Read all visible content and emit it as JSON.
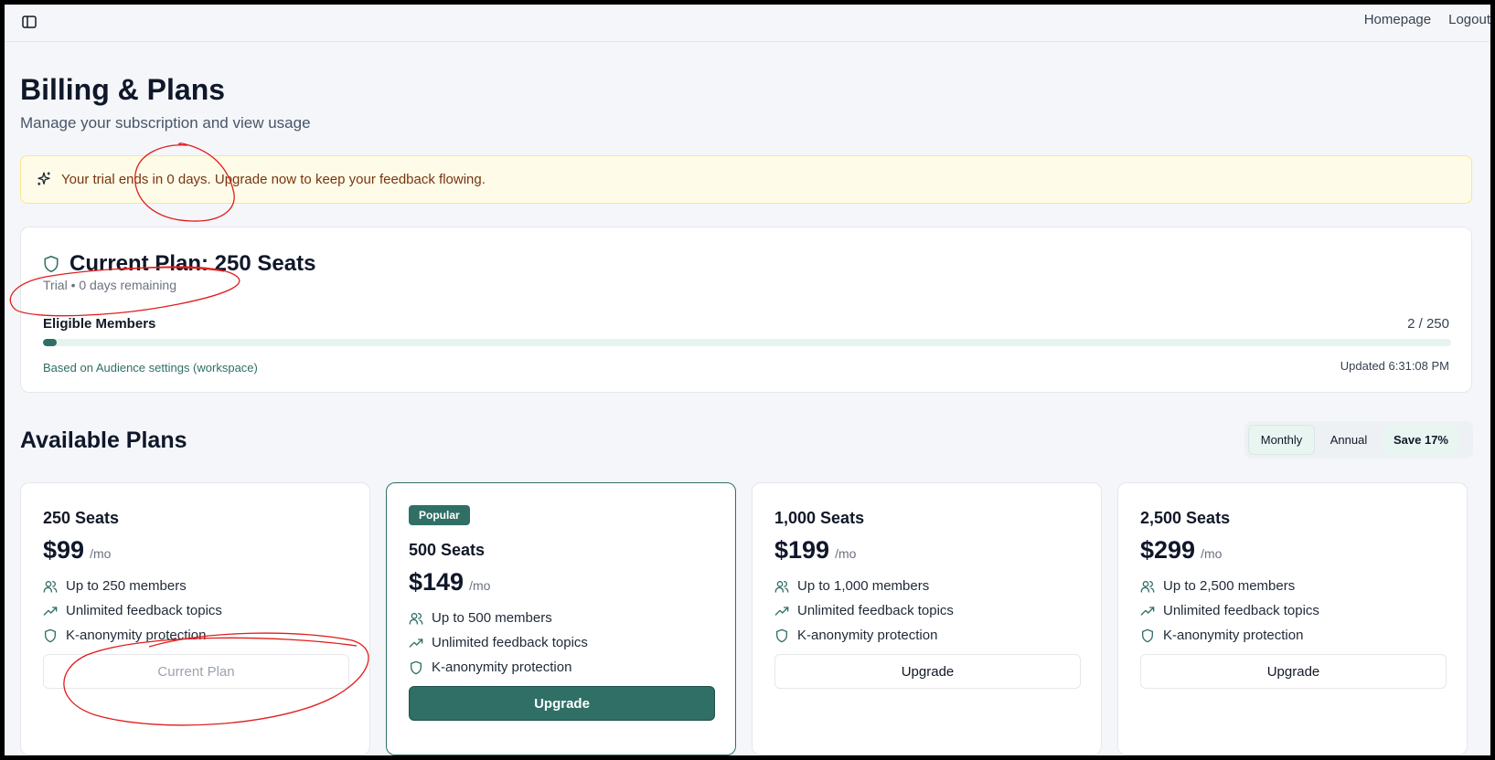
{
  "topbar": {
    "links": [
      "Homepage",
      "Logout"
    ]
  },
  "page": {
    "title": "Billing & Plans",
    "subtitle": "Manage your subscription and view usage"
  },
  "trial_banner": {
    "text": "Your trial ends in 0 days. Upgrade now to keep your feedback flowing."
  },
  "current_plan": {
    "title": "Current Plan: 250 Seats",
    "status": "Trial • 0 days remaining",
    "members_label": "Eligible Members",
    "members_count": "2 / 250",
    "usage_fraction": 0.008,
    "source": "Based on Audience settings (workspace)",
    "updated": "Updated 6:31:08 PM"
  },
  "available_plans": {
    "heading": "Available Plans",
    "billing_toggle": {
      "monthly": "Monthly",
      "annual": "Annual",
      "save": "Save 17%"
    },
    "plans": [
      {
        "name": "250 Seats",
        "price": "$99",
        "period": "/mo",
        "features": [
          "Up to 250 members",
          "Unlimited feedback topics",
          "K-anonymity protection"
        ],
        "button": "Current Plan"
      },
      {
        "badge": "Popular",
        "name": "500 Seats",
        "price": "$149",
        "period": "/mo",
        "features": [
          "Up to 500 members",
          "Unlimited feedback topics",
          "K-anonymity protection"
        ],
        "button": "Upgrade"
      },
      {
        "name": "1,000 Seats",
        "price": "$199",
        "period": "/mo",
        "features": [
          "Up to 1,000 members",
          "Unlimited feedback topics",
          "K-anonymity protection"
        ],
        "button": "Upgrade"
      },
      {
        "name": "2,500 Seats",
        "price": "$299",
        "period": "/mo",
        "features": [
          "Up to 2,500 members",
          "Unlimited feedback topics",
          "K-anonymity protection"
        ],
        "button": "Upgrade"
      }
    ]
  },
  "colors": {
    "brand": "#2f6f66",
    "banner_bg": "#fefce8",
    "annotation": "#e11d1d"
  },
  "icons": [
    "sidebar-toggle-icon",
    "sparkles-icon",
    "shield-icon",
    "users-icon",
    "trending-up-icon"
  ]
}
